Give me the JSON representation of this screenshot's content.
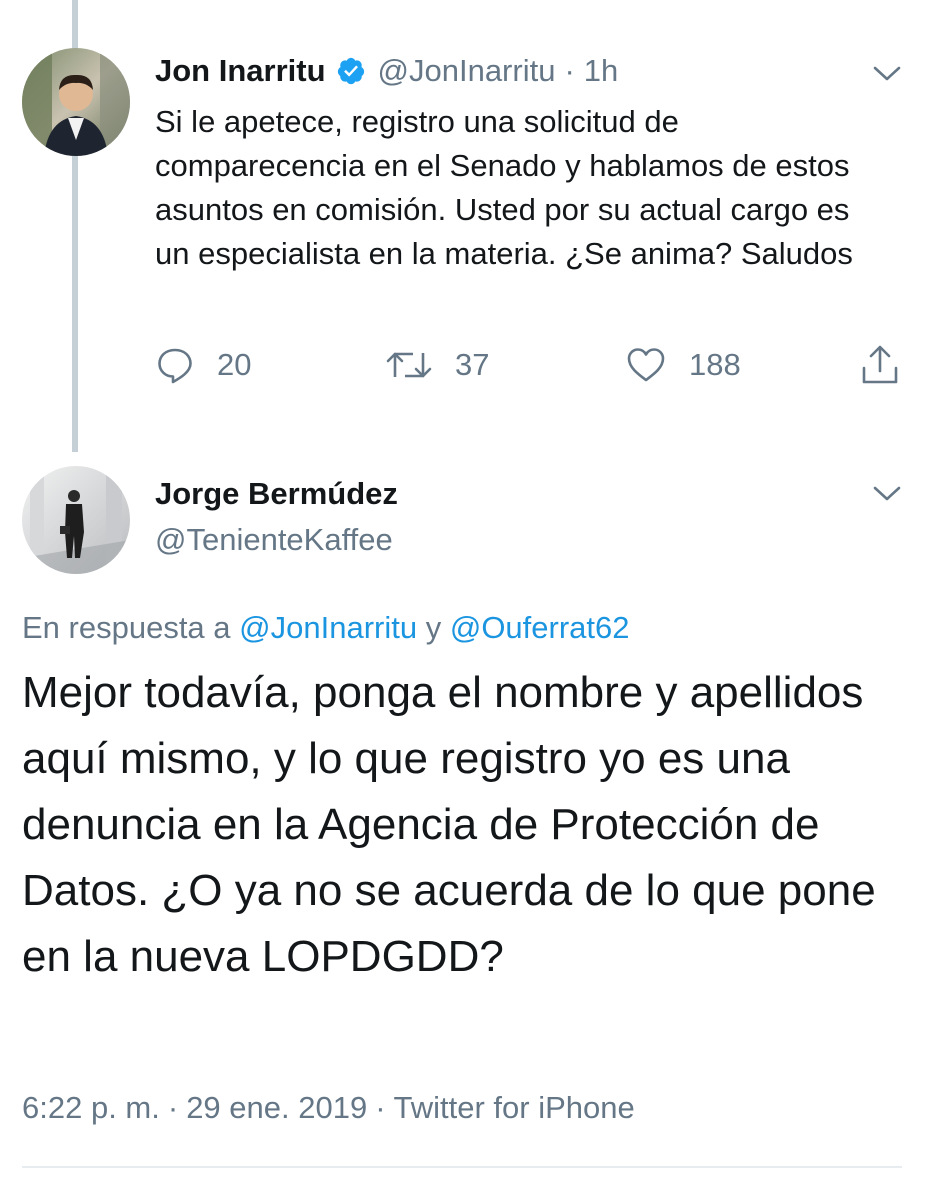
{
  "tweet1": {
    "author_name": "Jon Inarritu",
    "author_handle": "@JonInarritu",
    "time": "1h",
    "text": "Si le apetece, registro una solicitud de comparecencia en el Senado y hablamos de estos asuntos en comisión. Usted por su actual cargo es un especialista en la materia. ¿Se anima? Saludos",
    "replies": "20",
    "retweets": "37",
    "likes": "188",
    "verified": true,
    "icons": {
      "avatar": "profile-photo",
      "verified": "verified-badge-icon",
      "menu": "chevron-down-icon",
      "reply": "reply-icon",
      "retweet": "retweet-icon",
      "like": "heart-icon",
      "share": "share-icon"
    }
  },
  "tweet2": {
    "author_name": "Jorge Bermúdez",
    "author_handle": "@TenienteKaffee",
    "reply_prefix": "En respuesta a",
    "reply_mention_1": "@JonInarritu",
    "reply_conjunction": "y",
    "reply_mention_2": "@Ouferrat62",
    "text": "Mejor todavía, ponga el nombre y apellidos aquí mismo, y lo que registro yo es una denuncia en la Agencia de Protección de Datos. ¿O ya no se acuerda de lo que pone en la nueva LOPDGDD?",
    "time": "6:22 p. m.",
    "date": "29 ene. 2019",
    "source": "Twitter for iPhone",
    "separator": "·"
  },
  "colors": {
    "text_primary": "#14171a",
    "text_secondary": "#657786",
    "link": "#1b95e0",
    "verified": "#1da1f2",
    "thread_line": "#c4cfd6"
  }
}
